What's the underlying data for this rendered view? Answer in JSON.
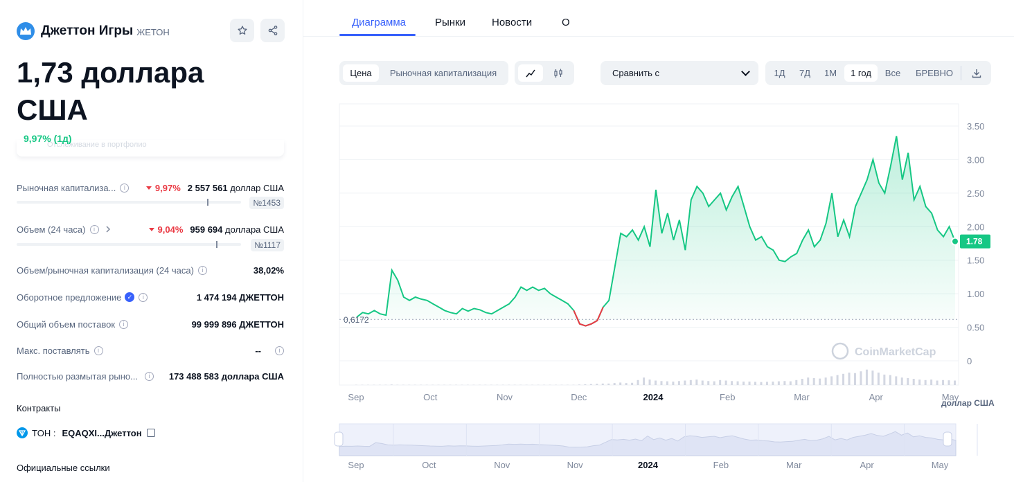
{
  "coin": {
    "name": "Джеттон Игры",
    "symbol": "ЖЕТОН"
  },
  "price": {
    "value": "1,73 доллара США",
    "change": "9,97% (1д)"
  },
  "ghost_text": "Отслеживание в портфолио",
  "stats": {
    "market_cap": {
      "label": "Рыночная капитализа...",
      "pct": "9,97%",
      "value": "2 557 561",
      "unit": "доллар США",
      "rank": "№1453",
      "rank_pos": 0.85
    },
    "volume": {
      "label": "Объем (24 часа)",
      "pct": "9,04%",
      "value": "959 694",
      "unit": "доллара США",
      "rank": "№1117",
      "rank_pos": 0.89
    },
    "vol_mcap": {
      "label": "Объем/рыночная капитализация (24 часа)",
      "value": "38,02%"
    },
    "circ_supply": {
      "label": "Оборотное предложение",
      "value": "1 474 194 ДЖЕТТОН"
    },
    "total_supply": {
      "label": "Общий объем поставок",
      "value": "99 999 896 ДЖЕТТОН"
    },
    "max_supply": {
      "label": "Макс. поставлять",
      "value": "--"
    },
    "fdv": {
      "label": "Полностью размытая рыно...",
      "value": "173 488 583 доллара США"
    }
  },
  "contracts": {
    "title": "Контракты",
    "chain": "TOH :",
    "address": "EQAQXI...Джеттон"
  },
  "links_title": "Официальные ссылки",
  "tabs": [
    "Диаграмма",
    "Рынки",
    "Новости",
    "О"
  ],
  "type_toggle": [
    "Цена",
    "Рыночная капитализация"
  ],
  "compare": "Сравнить с",
  "ranges": [
    "1Д",
    "7Д",
    "1М",
    "1 год",
    "Все",
    "БРЕВНО"
  ],
  "active_range": "1 год",
  "icons": {
    "logo": "jetton-crown-icon",
    "star": "star-icon",
    "share": "share-icon",
    "line": "line-chart-icon",
    "candle": "candlestick-icon",
    "download": "download-icon",
    "chevron": "chevron-down-icon"
  },
  "colors": {
    "accent": "#3861fb",
    "up": "#16c784",
    "down": "#ea3943"
  },
  "watermark": "CoinMarketCap",
  "chart_data": {
    "type": "area",
    "x_ticks": [
      "Sep",
      "Oct",
      "Nov",
      "Dec",
      "2024",
      "Feb",
      "Mar",
      "Apr",
      "May"
    ],
    "nav_ticks": [
      "Sep",
      "Oct",
      "Nov",
      "Nov",
      "2024",
      "Feb",
      "Mar",
      "Apr",
      "May"
    ],
    "y_ticks": [
      "3.50",
      "3.00",
      "2.50",
      "2.00",
      "1.50",
      "1.00",
      "0.50",
      "0"
    ],
    "ylim": [
      0,
      3.5
    ],
    "ylabel": "доллар США",
    "baseline": "0,6172",
    "baseline_value": 0.6172,
    "current": "1.78",
    "current_value": 1.78,
    "series": [
      {
        "values": [
          0.65,
          0.72,
          0.7,
          0.75,
          0.7,
          0.68,
          1.35,
          1.2,
          0.95,
          0.9,
          0.95,
          0.92,
          0.9,
          0.85,
          0.8,
          0.75,
          0.72,
          0.7,
          0.78,
          0.74,
          0.78,
          0.76,
          0.72,
          0.7,
          0.75,
          0.8,
          0.85,
          0.95,
          1.1,
          1.05,
          1.1,
          1.05,
          1.08,
          1.0,
          0.95,
          0.9,
          0.85,
          0.75,
          0.55,
          0.52,
          0.55,
          0.6,
          0.8,
          0.9,
          1.4,
          1.9,
          1.85,
          1.95,
          1.8,
          2.0,
          1.7,
          2.55,
          1.9,
          2.2,
          1.8,
          2.1,
          1.65,
          2.4,
          2.6,
          2.5,
          2.3,
          2.4,
          2.5,
          2.25,
          2.45,
          2.6,
          2.3,
          2.0,
          1.8,
          1.85,
          1.7,
          1.65,
          1.5,
          1.48,
          1.55,
          1.6,
          1.8,
          1.95,
          1.7,
          1.8,
          2.05,
          2.5,
          1.85,
          2.1,
          1.85,
          2.3,
          2.5,
          2.7,
          3.0,
          2.65,
          2.5,
          2.9,
          3.35,
          2.7,
          3.1,
          2.4,
          2.6,
          2.3,
          2.2,
          1.95,
          1.85,
          2.0,
          1.78
        ]
      },
      {
        "name": "volume",
        "values": [
          0.01,
          0.01,
          0.01,
          0.01,
          0.01,
          0.01,
          0.02,
          0.01,
          0.01,
          0.01,
          0.01,
          0.01,
          0.01,
          0.01,
          0.01,
          0.01,
          0.01,
          0.01,
          0.01,
          0.01,
          0.01,
          0.01,
          0.01,
          0.01,
          0.01,
          0.01,
          0.01,
          0.01,
          0.01,
          0.01,
          0.01,
          0.01,
          0.01,
          0.01,
          0.01,
          0.01,
          0.01,
          0.01,
          0.02,
          0.03,
          0.04,
          0.05,
          0.06,
          0.06,
          0.08,
          0.1,
          0.08,
          0.09,
          0.2,
          0.3,
          0.22,
          0.18,
          0.16,
          0.15,
          0.14,
          0.16,
          0.18,
          0.2,
          0.22,
          0.18,
          0.16,
          0.15,
          0.2,
          0.18,
          0.16,
          0.15,
          0.14,
          0.14,
          0.13,
          0.12,
          0.13,
          0.14,
          0.15,
          0.16,
          0.15,
          0.2,
          0.25,
          0.3,
          0.28,
          0.26,
          0.3,
          0.35,
          0.4,
          0.45,
          0.5,
          0.48,
          0.55,
          0.62,
          0.58,
          0.5,
          0.42,
          0.4,
          0.35,
          0.3,
          0.28,
          0.25,
          0.22,
          0.2,
          0.22,
          0.18,
          0.2,
          0.19,
          0.18
        ]
      }
    ]
  }
}
